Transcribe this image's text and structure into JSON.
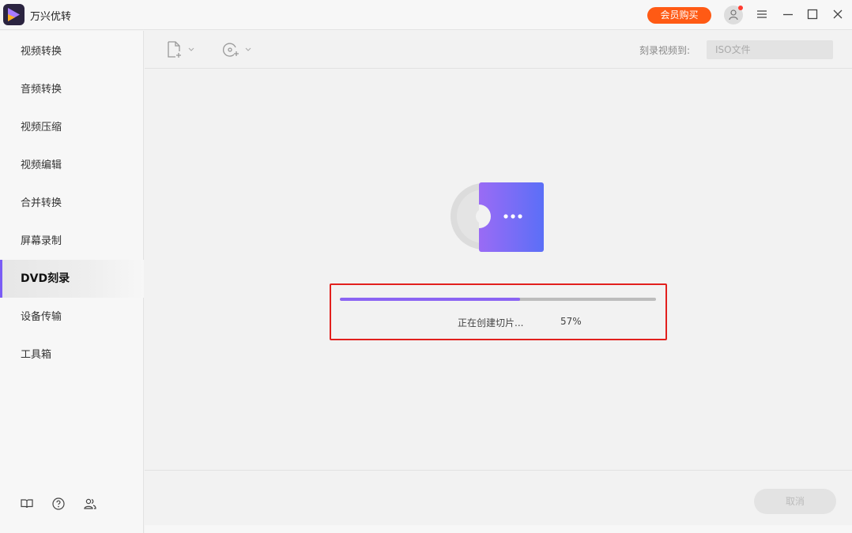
{
  "app": {
    "title": "万兴优转",
    "vip_button": "会员购买"
  },
  "sidebar": {
    "items": [
      {
        "label": "视频转换",
        "active": false
      },
      {
        "label": "音频转换",
        "active": false
      },
      {
        "label": "视频压缩",
        "active": false
      },
      {
        "label": "视频编辑",
        "active": false
      },
      {
        "label": "合并转换",
        "active": false
      },
      {
        "label": "屏幕录制",
        "active": false
      },
      {
        "label": "DVD刻录",
        "active": true
      },
      {
        "label": "设备传输",
        "active": false
      },
      {
        "label": "工具箱",
        "active": false
      }
    ],
    "bottom_icons": [
      "book-icon",
      "help-icon",
      "users-icon"
    ]
  },
  "toolbar": {
    "icons": [
      "add-file-icon",
      "add-disc-icon"
    ],
    "burn_to_label": "刻录视频到:",
    "burn_to_value": "ISO文件"
  },
  "progress": {
    "status_text": "正在创建切片...",
    "percent_text": "57%",
    "percent": 57
  },
  "footer": {
    "cancel_label": "取消"
  },
  "colors": {
    "accent": "#8b64f3",
    "vip": "#ff5a14",
    "highlight_border": "#e2201d"
  }
}
